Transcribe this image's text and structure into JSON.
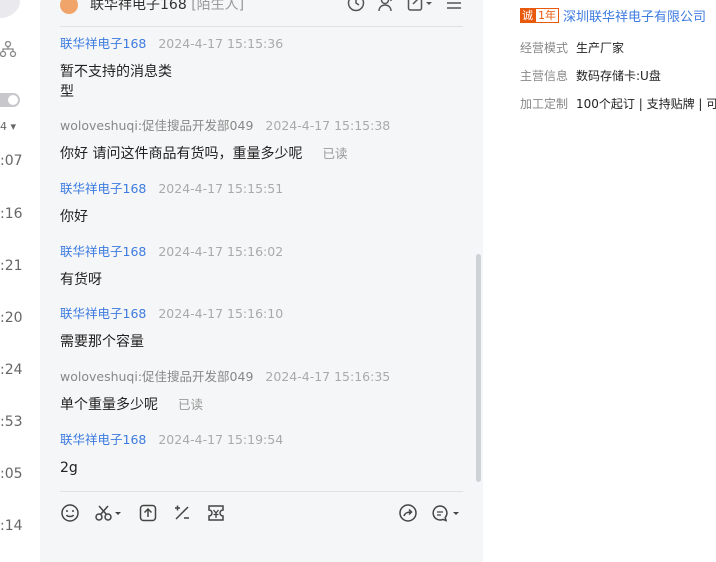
{
  "left_list": {
    "times": [
      ":07",
      ":16",
      ":21",
      ":20",
      ":24",
      ":53",
      ":05",
      ":14"
    ]
  },
  "chat": {
    "header": {
      "title": "联华祥电子168",
      "tag": "[陌生人]"
    },
    "messages": [
      {
        "sender": "联华祥电子168",
        "role": "shop",
        "time": "2024-4-17 15:15:36",
        "text": "暂不支持的消息类\n型",
        "status": ""
      },
      {
        "sender": "woloveshuqi:促佳搜品开发部049",
        "role": "buyer",
        "time": "2024-4-17 15:15:38",
        "text": "你好 请问这件商品有货吗，重量多少呢",
        "status": "已读"
      },
      {
        "sender": "联华祥电子168",
        "role": "shop",
        "time": "2024-4-17 15:15:51",
        "text": "你好",
        "status": ""
      },
      {
        "sender": "联华祥电子168",
        "role": "shop",
        "time": "2024-4-17 15:16:02",
        "text": "有货呀",
        "status": ""
      },
      {
        "sender": "联华祥电子168",
        "role": "shop",
        "time": "2024-4-17 15:16:10",
        "text": "需要那个容量",
        "status": ""
      },
      {
        "sender": "woloveshuqi:促佳搜品开发部049",
        "role": "buyer",
        "time": "2024-4-17 15:16:35",
        "text": "单个重量多少呢",
        "status": "已读"
      },
      {
        "sender": "联华祥电子168",
        "role": "shop",
        "time": "2024-4-17 15:19:54",
        "text": "2g",
        "status": ""
      }
    ],
    "toolbar_icons": [
      "emoji-icon",
      "scissors-icon",
      "upload-icon",
      "percent-icon",
      "coupon-icon",
      "forward-icon",
      "quick-reply-icon"
    ]
  },
  "shop": {
    "badge_1": "诚",
    "badge_2": "1年",
    "name": "深圳联华祥电子有限公司",
    "rows": [
      {
        "label": "经营模式",
        "value": "生产厂家"
      },
      {
        "label": "主营信息",
        "value": "数码存储卡:U盘"
      },
      {
        "label": "加工定制",
        "value": "100个起订 | 支持贴牌 | 可打"
      }
    ]
  },
  "colors": {
    "shop_blue": "#3d7be0",
    "badge_orange": "#e8590c",
    "chat_bg": "#f5f6f7"
  }
}
